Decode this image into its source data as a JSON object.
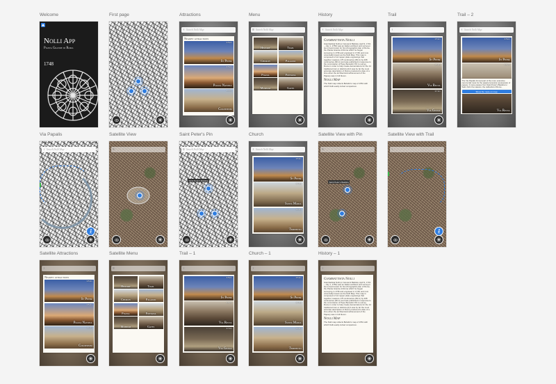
{
  "artboards": {
    "welcome": {
      "title": "Welcome",
      "app_title": "Nolli App",
      "app_subtitle": "Pianta Grande di Roma",
      "year": "1748"
    },
    "first_page": {
      "title": "First page"
    },
    "attractions": {
      "title": "Attractions",
      "search_placeholder": "Search Nolli Map",
      "heading": "Nearby attractions",
      "items": [
        {
          "name": "St Peter",
          "dist": "0.5 km"
        },
        {
          "name": "Piazza Navona",
          "dist": "0.5 km"
        },
        {
          "name": "Colosseum",
          "dist": "1.1 km"
        }
      ]
    },
    "menu": {
      "title": "Menu",
      "search_placeholder": "Search Nolli Map",
      "tiles": [
        "History",
        "Trail",
        "Church",
        "Palazzo",
        "Piazza",
        "Fontana",
        "Museum",
        "Gates"
      ]
    },
    "history": {
      "title": "History",
      "search_placeholder": "Search Nolli Map",
      "heading": "Giambattista Nolli",
      "body": "Giambattista Nolli (or Giovanni Battista; April 9, 1701 – July 1, 1756) was an Italian architect and surveyor. He is best known for his ichnographic plan of Rome, the Pianta Grande di Roma which he began surveying in 1736 and engraved in 1748, and now universally known as the Nolli Map. This map is composed of 12 copper plate engravings that together measure 176 centimetres (69 in) by 208 centimetres (82 in) and was published in response to the commission of Pope Benedict XIV to survey Rome in order to help create demarcations for the 14 traditional rioni or districts [2] It was by far the most accurate description of Rome produced to date of a time when the architectural achievement of the Papacy was in full bloom.",
      "heading2": "Nolli Map",
      "body2": "The Nolli map reflects Bufalini's map of 1551 with which Nolli easily invited comparison."
    },
    "trail": {
      "title": "Trail",
      "items": [
        {
          "name": "St Peter",
          "dist": "0.5 km"
        },
        {
          "name": "Via Recta",
          "dist": "0.6 km"
        },
        {
          "name": "Via Giulia",
          "dist": "0.7 km"
        }
      ]
    },
    "trail2": {
      "title": "Trail – 2",
      "search_placeholder": "Search Nolli Map",
      "card_text": "The Via Papalis formed part of the more extensive ceremonial route for the papal procession (possessio) of papacy. It route passes from Saint Peter's Basilica to Saint John the Lateran, the cathedral of Rome.",
      "button": "Show the route on map",
      "items": [
        {
          "name": "St Peter",
          "dist": "0.5 km"
        },
        {
          "name": "Via Recta",
          "dist": "0.6 km"
        }
      ]
    },
    "via_papalis": {
      "title": "Via Papalis",
      "search_placeholder": "Search Nolli Map"
    },
    "satellite_view": {
      "title": "Satellite View"
    },
    "saint_peters_pin": {
      "title": "Saint Peter's Pin",
      "search_placeholder": "Search Nolli Map",
      "pin_label": "Saint Peter's Basilica"
    },
    "church": {
      "title": "Church",
      "search_placeholder": "Search Nolli Map",
      "items": [
        {
          "name": "St Peter",
          "dist": "0.5 km"
        },
        {
          "name": "Santa Maria",
          "dist": "0.4 km"
        },
        {
          "name": "Tempietto",
          "dist": "0.9 km"
        }
      ]
    },
    "satellite_pin": {
      "title": "Satellite View with Pin",
      "pin_label": "Saint Peter's Basilica"
    },
    "satellite_trail": {
      "title": "Satellite View with Trail"
    },
    "satellite_attractions": {
      "title": "Satellite Attractions",
      "heading": "Nearby attractions",
      "items": [
        {
          "name": "St Peter",
          "dist": "0.5 km"
        },
        {
          "name": "Piazza Navona",
          "dist": "0.5 km"
        },
        {
          "name": "Colosseum",
          "dist": "1.1 km"
        }
      ]
    },
    "satellite_menu": {
      "title": "Satellite Menu",
      "tiles": [
        "History",
        "Trail",
        "Church",
        "Palazzo",
        "Piazza",
        "Fontana",
        "Museum",
        "Gates"
      ]
    },
    "trail1": {
      "title": "Trail – 1",
      "items": [
        {
          "name": "St Peter",
          "dist": "0.5 km"
        },
        {
          "name": "Via Recta",
          "dist": "0.6 km"
        },
        {
          "name": "Via Giulia",
          "dist": "0.7 km"
        }
      ]
    },
    "church1": {
      "title": "Church – 1",
      "items": [
        {
          "name": "St Peter",
          "dist": "0.5 km"
        },
        {
          "name": "Santa Maria",
          "dist": "0.4 km"
        },
        {
          "name": "Tempietto",
          "dist": "0.9 km"
        }
      ]
    },
    "history1": {
      "title": "History – 1",
      "heading": "Giambattista Nolli",
      "body": "Giambattista Nolli (or Giovanni Battista; April 9, 1701 – July 1, 1756) was an Italian architect and surveyor. He is best known for his ichnographic plan of Rome, the Pianta Grande di Roma which he began surveying in 1736 and engraved in 1748, and now universally known as the Nolli Map. This map is composed of 12 copper plate engravings that together measure 176 centimetres (69 in) by 208 centimetres (82 in) and was published in response to the commission of Pope Benedict XIV to survey Rome in order to help create demarcations for the 14 traditional rioni or districts [2] It was by far the most accurate description of Rome produced to date of a time when the architectural achievement of the Papacy was in full bloom.",
      "heading2": "Nolli Map",
      "body2": "The Nolli map reflects Bufalini's map of 1551 with which Nolli easily invited comparison."
    }
  },
  "status": {
    "carrier": "•••• Carrier",
    "time": "9:41 AM",
    "battery": "100%"
  },
  "colors": {
    "accent": "#2f7de0",
    "panel": "#fbf9f3",
    "canvas": "#f4f4f4"
  }
}
